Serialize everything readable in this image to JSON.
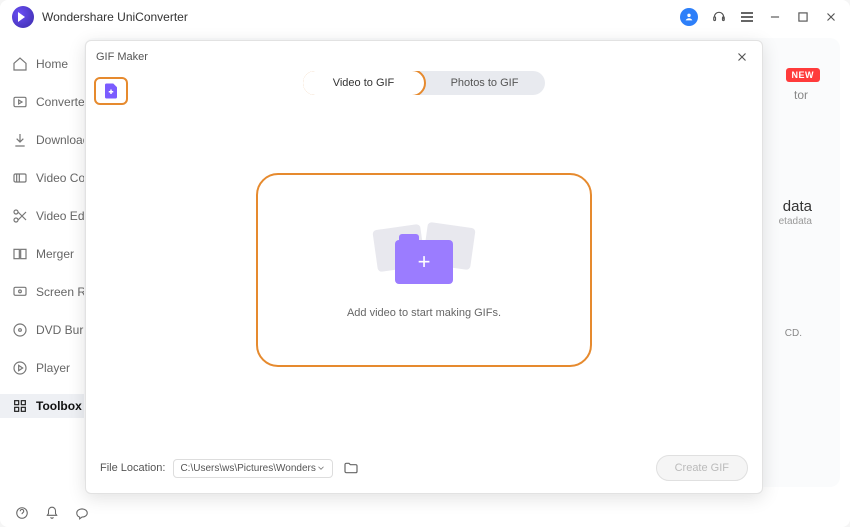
{
  "app": {
    "title": "Wondershare UniConverter"
  },
  "titlebar": {
    "user_icon": "user-avatar",
    "support_icon": "headset-icon",
    "menu_icon": "hamburger-icon"
  },
  "sidebar": {
    "items": [
      {
        "label": "Home"
      },
      {
        "label": "Converter"
      },
      {
        "label": "Downloader"
      },
      {
        "label": "Video Compressor"
      },
      {
        "label": "Video Editor"
      },
      {
        "label": "Merger"
      },
      {
        "label": "Screen Recorder"
      },
      {
        "label": "DVD Burner"
      },
      {
        "label": "Player"
      },
      {
        "label": "Toolbox"
      }
    ]
  },
  "background": {
    "new_badge": "NEW",
    "tor_text": "tor",
    "metadata_title": "data",
    "metadata_sub": "etadata",
    "cd_snippet": "CD."
  },
  "modal": {
    "title": "GIF Maker",
    "tabs": {
      "video": "Video to GIF",
      "photos": "Photos to GIF"
    },
    "drop_text": "Add video to start making GIFs.",
    "location_label": "File Location:",
    "location_path": "C:\\Users\\ws\\Pictures\\Wonders",
    "create_btn": "Create GIF"
  }
}
